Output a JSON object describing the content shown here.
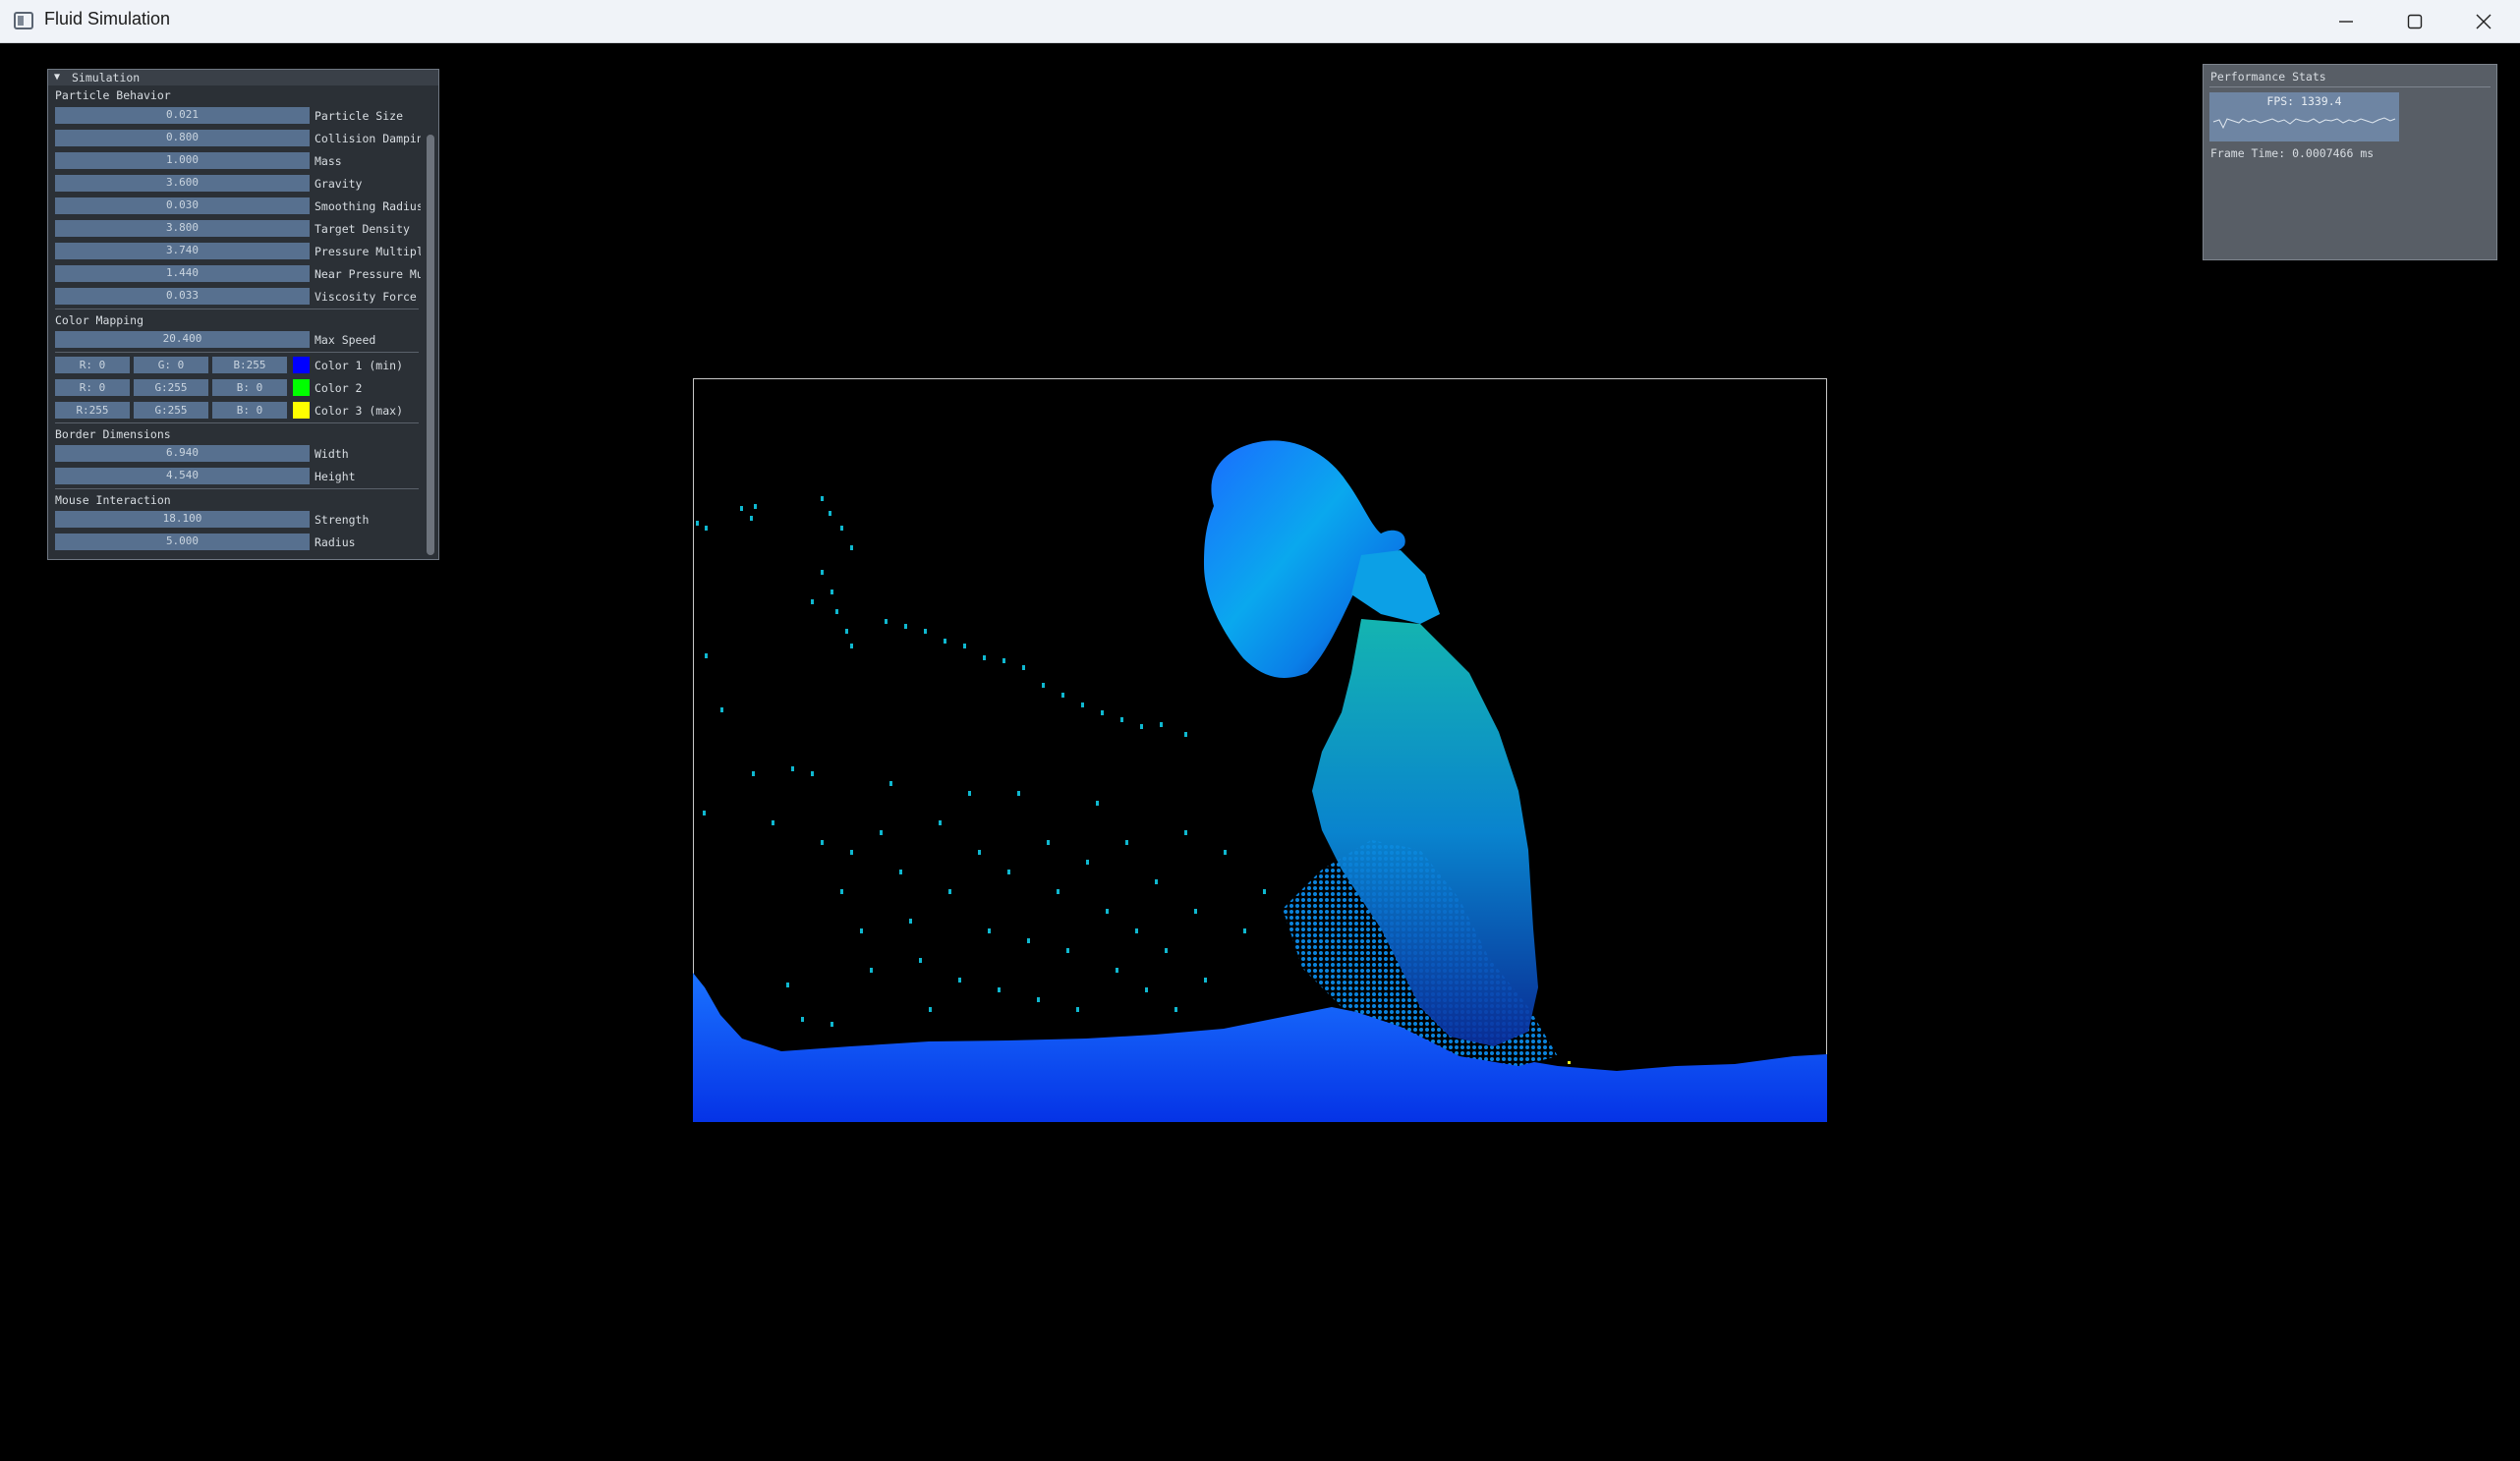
{
  "window": {
    "title": "Fluid Simulation",
    "minimize_icon": "minimize-icon",
    "maximize_icon": "maximize-icon",
    "close_icon": "close-icon"
  },
  "panel": {
    "title": "Simulation",
    "sections": {
      "particle_behavior": "Particle Behavior",
      "color_mapping": "Color Mapping",
      "border_dimensions": "Border Dimensions",
      "mouse_interaction": "Mouse Interaction"
    },
    "particle_sliders": [
      {
        "value": "0.021",
        "label": "Particle Size"
      },
      {
        "value": "0.800",
        "label": "Collision Dampin"
      },
      {
        "value": "1.000",
        "label": "Mass"
      },
      {
        "value": "3.600",
        "label": "Gravity"
      },
      {
        "value": "0.030",
        "label": "Smoothing Radius"
      },
      {
        "value": "3.800",
        "label": "Target Density"
      },
      {
        "value": "3.740",
        "label": "Pressure Multipl"
      },
      {
        "value": "1.440",
        "label": "Near Pressure Mu"
      },
      {
        "value": "0.033",
        "label": "Viscosity Force"
      }
    ],
    "max_speed": {
      "value": "20.400",
      "label": "Max Speed"
    },
    "colors": [
      {
        "r": "R:  0",
        "g": "G:  0",
        "b": "B:255",
        "swatch": "#0000ff",
        "label": "Color 1 (min)"
      },
      {
        "r": "R:  0",
        "g": "G:255",
        "b": "B:  0",
        "swatch": "#00ff00",
        "label": "Color 2"
      },
      {
        "r": "R:255",
        "g": "G:255",
        "b": "B:  0",
        "swatch": "#ffff00",
        "label": "Color 3 (max)"
      }
    ],
    "border_sliders": [
      {
        "value": "6.940",
        "label": "Width"
      },
      {
        "value": "4.540",
        "label": "Height"
      }
    ],
    "mouse_sliders": [
      {
        "value": "18.100",
        "label": "Strength"
      },
      {
        "value": "5.000",
        "label": "Radius"
      }
    ]
  },
  "performance": {
    "title": "Performance Stats",
    "fps": "FPS: 1339.4",
    "frame_time": "Frame Time: 0.0007466 ms"
  }
}
